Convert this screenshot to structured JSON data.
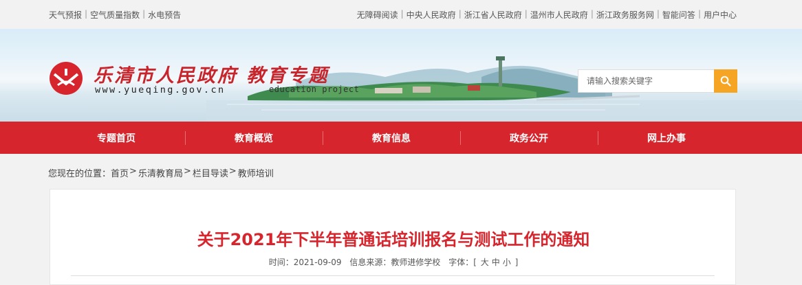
{
  "topbar": {
    "left_links": [
      "天气预报",
      "空气质量指数",
      "水电预告"
    ],
    "right_links": [
      "无障碍阅读",
      "中央人民政府",
      "浙江省人民政府",
      "温州市人民政府",
      "浙江政务服务网",
      "智能问答",
      "用户中心"
    ]
  },
  "header": {
    "title": "乐清市人民政府  教育专题",
    "url_text": "www.yueqing.gov.cn",
    "subtitle": "education project",
    "search_placeholder": "请输入搜索关键字"
  },
  "nav": {
    "items": [
      "专题首页",
      "教育概览",
      "教育信息",
      "政务公开",
      "网上办事"
    ]
  },
  "breadcrumb": {
    "prefix": "您现在的位置：",
    "items": [
      "首页",
      "乐清教育局",
      "栏目导读",
      "教师培训"
    ]
  },
  "article": {
    "title": "关于2021年下半年普通话培训报名与测试工作的通知",
    "time_label": "时间：",
    "time": "2021-09-09",
    "source_label": "信息来源：",
    "source": "教师进修学校",
    "fontsize_label": "字体：",
    "fontsize_options": [
      "大",
      "中",
      "小"
    ]
  },
  "colors": {
    "brand_red": "#d7252d",
    "search_orange": "#f5a523"
  },
  "icons": {
    "search": "magnifier-icon",
    "emblem": "logo-emblem"
  }
}
